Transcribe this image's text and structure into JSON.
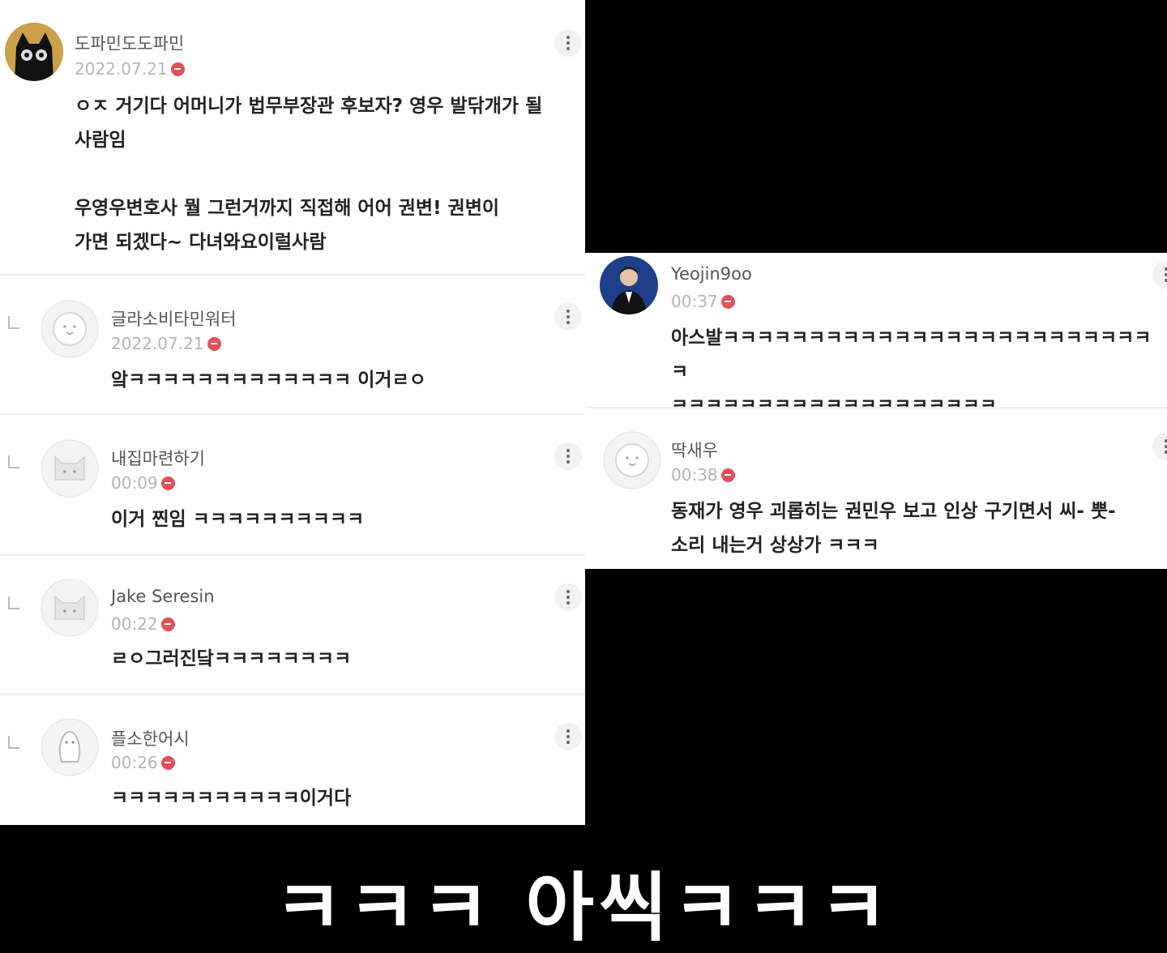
{
  "left_comments": [
    {
      "username": "도파민도도파민",
      "date": "2022.07.21",
      "text": "ㅇㅈ 거기다 어머니가 법무부장관 후보자? 영우 발닦개가 될\n사람임\n\n우영우변호사 뭘 그런거까지 직접해 어어 권변! 권변이\n가면 되겠다~ 다녀와요이럴사람",
      "avatar": "black-cat-avatar"
    },
    {
      "username": "글라소비타민워터",
      "date": "2022.07.21",
      "text": "앜ㅋㅋㅋㅋㅋㅋㅋㅋㅋㅋㅋㅋㅋ 이거ㄹㅇ",
      "avatar": "default-bear-avatar"
    },
    {
      "username": "내집마련하기",
      "date": "00:09",
      "text": "이거 찐임 ㅋㅋㅋㅋㅋㅋㅋㅋㅋㅋ",
      "avatar": "default-cat-avatar"
    },
    {
      "username": "Jake Seresin",
      "date": "00:22",
      "text": "ㄹㅇ그러진닼ㅋㅋㅋㅋㅋㅋㅋㅋ",
      "avatar": "default-cat-avatar"
    },
    {
      "username": "플소한어시",
      "date": "00:26",
      "text": "ㅋㅋㅋㅋㅋㅋㅋㅋㅋㅋㅋ이거다",
      "avatar": "default-penguin-avatar"
    }
  ],
  "right_comments": [
    {
      "username": "Yeojin9oo",
      "date": "00:37",
      "text": "아스발ㅋㅋㅋㅋㅋㅋㅋㅋㅋㅋㅋㅋㅋㅋㅋㅋㅋㅋㅋㅋㅋㅋㅋㅋㅋㅋ\nㅋㅋㅋㅋㅋㅋㅋㅋㅋㅋㅋㅋㅋㅋㅋㅋㅋㅋㅋ",
      "avatar": "photo-avatar"
    },
    {
      "username": "딱새우",
      "date": "00:38",
      "text": "동재가 영우 괴롭히는 권민우 보고 인상 구기면서 씨- 뿟-\n소리 내는거 상상가 ㅋㅋㅋ",
      "avatar": "default-bear-avatar"
    }
  ],
  "caption": "ㅋㅋㅋ 아씩ㅋㅋㅋ",
  "colors": {
    "badge": "#e4505a",
    "date": "#b5b5b5",
    "username": "#555555",
    "background": "#000000",
    "panel": "#ffffff"
  }
}
